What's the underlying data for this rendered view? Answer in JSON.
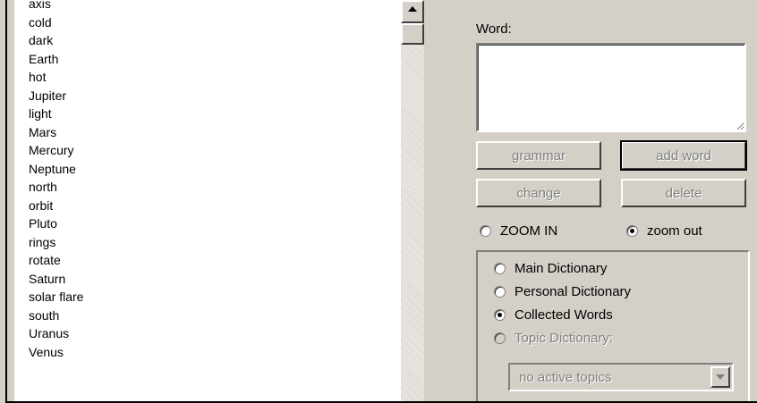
{
  "word_list": {
    "items": [
      "axis",
      "cold",
      "dark",
      "Earth",
      "hot",
      "Jupiter",
      "light",
      "Mars",
      "Mercury",
      "Neptune",
      "north",
      "orbit",
      "Pluto",
      "rings",
      "rotate",
      "Saturn",
      "solar flare",
      "south",
      "Uranus",
      "Venus"
    ]
  },
  "word_panel": {
    "label": "Word:",
    "value": ""
  },
  "buttons": {
    "grammar": "grammar",
    "add_word": "add word",
    "change": "change",
    "delete": "delete"
  },
  "zoom": {
    "zoom_in": "ZOOM IN",
    "zoom_out": "zoom out",
    "selected": "zoom_out"
  },
  "dictionary": {
    "main": "Main Dictionary",
    "personal": "Personal Dictionary",
    "collected": "Collected Words",
    "topic": "Topic Dictionary:",
    "selected": "collected",
    "topic_select_value": "no active topics"
  },
  "icons": {
    "scroll_up": "arrow-up-icon",
    "dropdown": "chevron-down-icon"
  }
}
